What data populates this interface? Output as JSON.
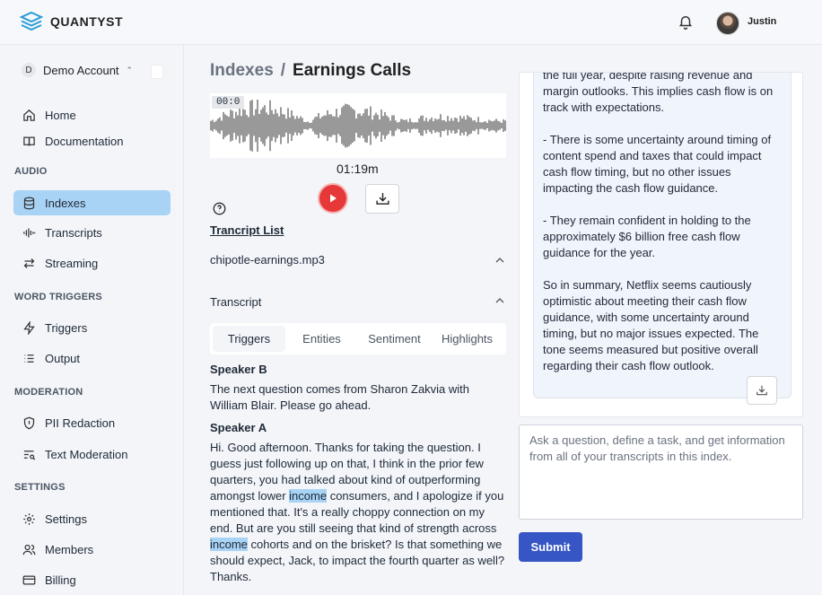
{
  "app": {
    "name": "QUANTYST"
  },
  "header": {
    "user_name": "Justin"
  },
  "sidebar": {
    "account": {
      "badge": "D",
      "name": "Demo Account",
      "chevron": "⌃⌄"
    },
    "top_items": [
      {
        "label": "Home",
        "icon": "home-icon"
      },
      {
        "label": "Documentation",
        "icon": "book-icon"
      }
    ],
    "sections": [
      {
        "label": "AUDIO",
        "items": [
          {
            "label": "Indexes",
            "icon": "database-icon",
            "active": true
          },
          {
            "label": "Transcripts",
            "icon": "waveform-icon"
          },
          {
            "label": "Streaming",
            "icon": "arrows-icon"
          }
        ]
      },
      {
        "label": "WORD TRIGGERS",
        "items": [
          {
            "label": "Triggers",
            "icon": "bolt-icon"
          },
          {
            "label": "Output",
            "icon": "list-icon"
          }
        ]
      },
      {
        "label": "MODERATION",
        "items": [
          {
            "label": "PII Redaction",
            "icon": "shield-icon"
          },
          {
            "label": "Text Moderation",
            "icon": "text-search-icon"
          }
        ]
      },
      {
        "label": "SETTINGS",
        "items": [
          {
            "label": "Settings",
            "icon": "gear-icon"
          },
          {
            "label": "Members",
            "icon": "users-icon"
          },
          {
            "label": "Billing",
            "icon": "card-icon"
          }
        ]
      }
    ]
  },
  "breadcrumb": {
    "parent": "Indexes",
    "separator": "/",
    "current": "Earnings Calls"
  },
  "player": {
    "time": "00:0",
    "duration": "01:19m"
  },
  "transcript_list": {
    "title": "Trancript List",
    "file": "chipotle-earnings.mp3",
    "transcript_heading": "Transcript",
    "tabs": [
      "Triggers",
      "Entities",
      "Sentiment",
      "Highlights"
    ],
    "active_tab": "Triggers",
    "entries": [
      {
        "speaker": "Speaker B",
        "text": "The next question comes from Sharon Zakvia with William Blair. Please go ahead."
      },
      {
        "speaker": "Speaker A",
        "text_parts": [
          "Hi. Good afternoon. Thanks for taking the question. I guess just following up on that, I think in the prior few quarters, you had talked about kind of outperforming amongst lower ",
          "income",
          " consumers, and I apologize if you mentioned that. It's a really choppy connection on my end. But are you still seeing that kind of strength across ",
          "income",
          " cohorts and on the brisket? Is that something we should expect, Jack, to impact the fourth quarter as well? Thanks."
        ]
      }
    ]
  },
  "chat": {
    "response": "the full year, despite raising revenue and margin outlooks. This implies cash flow is on track with expectations.\n\n- There is some uncertainty around timing of content spend and taxes that could impact cash flow timing, but no other issues impacting the cash flow guidance.\n\n- They remain confident in holding to the approximately $6 billion free cash flow guidance for the year.\n\nSo in summary, Netflix seems cautiously optimistic about meeting their cash flow guidance, with some uncertainty around timing, but no major issues expected. The tone seems measured but positive overall regarding their cash flow outlook.",
    "prompt_placeholder": "Ask a question, define a task, and get information from all of your transcripts in this index.",
    "submit_label": "Submit"
  },
  "colors": {
    "accent": "#3556c4",
    "active_nav": "#a8d3f5",
    "play": "#e63838",
    "highlight": "#a8d3f5"
  }
}
